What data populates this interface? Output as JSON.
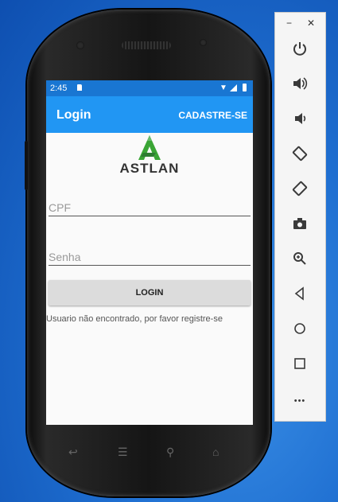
{
  "status_bar": {
    "time": "2:45"
  },
  "app_bar": {
    "title": "Login",
    "action": "CADASTRE-SE"
  },
  "logo": {
    "brand": "ASTLAN"
  },
  "form": {
    "cpf_placeholder": "CPF",
    "senha_placeholder": "Senha",
    "login_button": "LOGIN",
    "message": "Usuario não encontrado, por favor registre-se"
  },
  "phone_nav": {
    "back": "↩",
    "menu": "☰",
    "search": "⚲",
    "home": "⌂"
  },
  "emulator_panel": {
    "minimize": "−",
    "close": "✕",
    "icons": [
      "power-icon",
      "volume-up-icon",
      "volume-down-icon",
      "rotate-left-icon",
      "rotate-right-icon",
      "camera-icon",
      "zoom-icon",
      "back-icon",
      "home-icon",
      "overview-icon",
      "more-icon"
    ],
    "more": "•••"
  },
  "colors": {
    "status_bar": "#1976d2",
    "app_bar": "#2196f3",
    "logo_green": "#3aa535"
  }
}
